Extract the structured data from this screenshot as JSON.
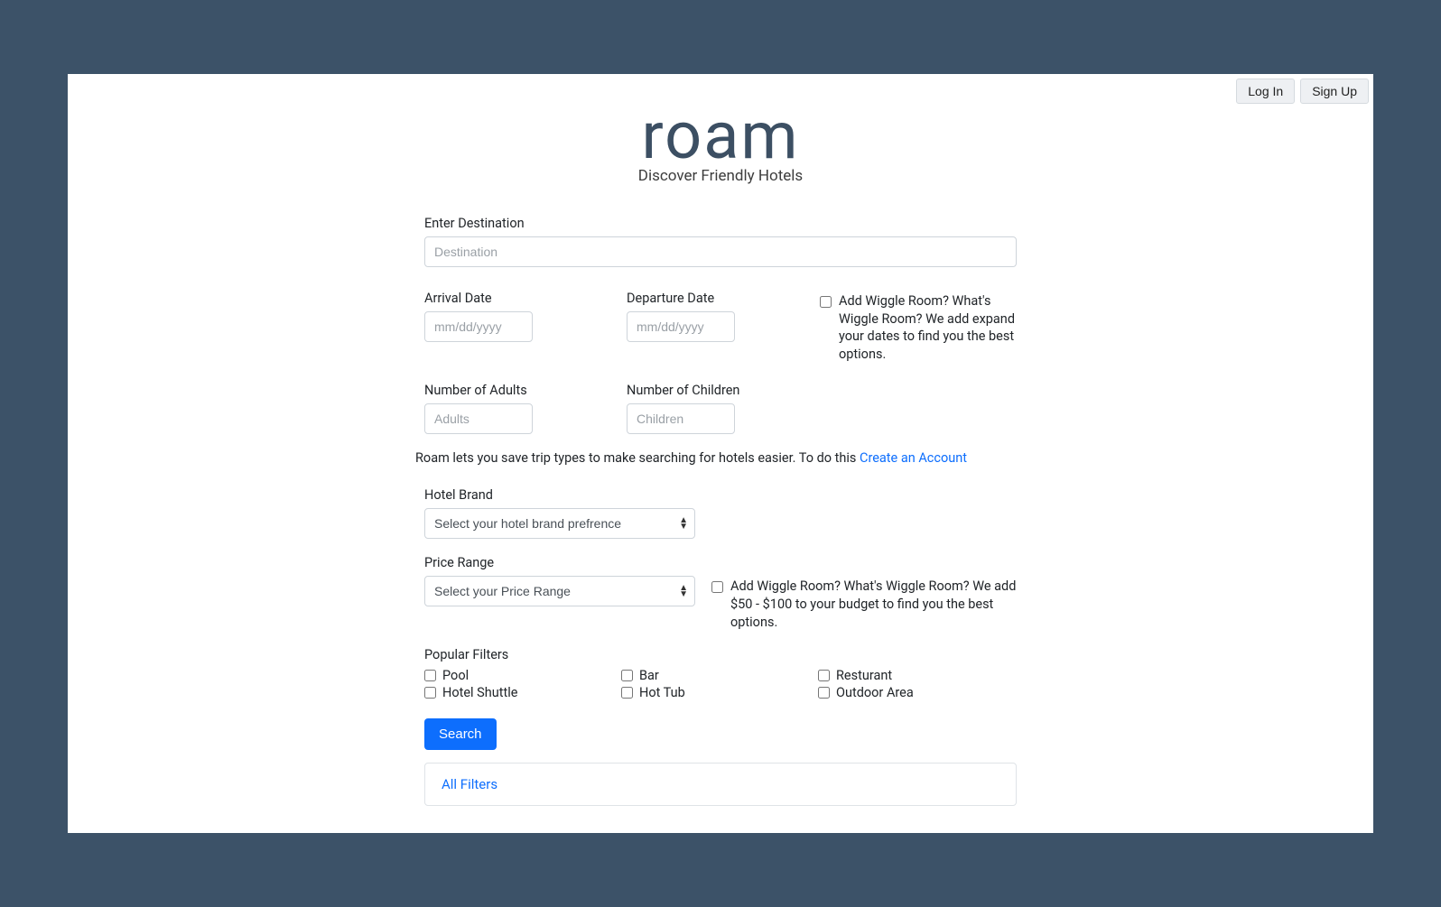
{
  "topbar": {
    "login": "Log In",
    "signup": "Sign Up"
  },
  "brand": {
    "logo": "roam",
    "tagline": "Discover Friendly Hotels"
  },
  "form": {
    "destination": {
      "label": "Enter Destination",
      "placeholder": "Destination"
    },
    "arrival": {
      "label": "Arrival Date",
      "placeholder": "mm/dd/yyyy"
    },
    "departure": {
      "label": "Departure Date",
      "placeholder": "mm/dd/yyyy"
    },
    "wiggle_dates": {
      "text": "Add Wiggle Room? What's Wiggle Room? We add expand your dates to find you the best options."
    },
    "adults": {
      "label": "Number of Adults",
      "placeholder": "Adults"
    },
    "children": {
      "label": "Number of Children",
      "placeholder": "Children"
    },
    "trip_intro": {
      "text": "Roam lets you save trip types to make searching for hotels easier. To do this ",
      "link": "Create an Account"
    },
    "brand_select": {
      "label": "Hotel Brand",
      "placeholder": "Select your hotel brand prefrence"
    },
    "price_select": {
      "label": "Price Range",
      "placeholder": "Select your Price Range"
    },
    "wiggle_price": {
      "text": "Add Wiggle Room? What's Wiggle Room? We add $50 - $100 to your budget to find you the best options."
    },
    "filters": {
      "label": "Popular Filters",
      "col1": [
        "Pool",
        "Hotel Shuttle"
      ],
      "col2": [
        "Bar",
        "Hot Tub"
      ],
      "col3": [
        "Resturant",
        "Outdoor Area"
      ]
    },
    "search_btn": "Search",
    "all_filters": "All Filters"
  }
}
